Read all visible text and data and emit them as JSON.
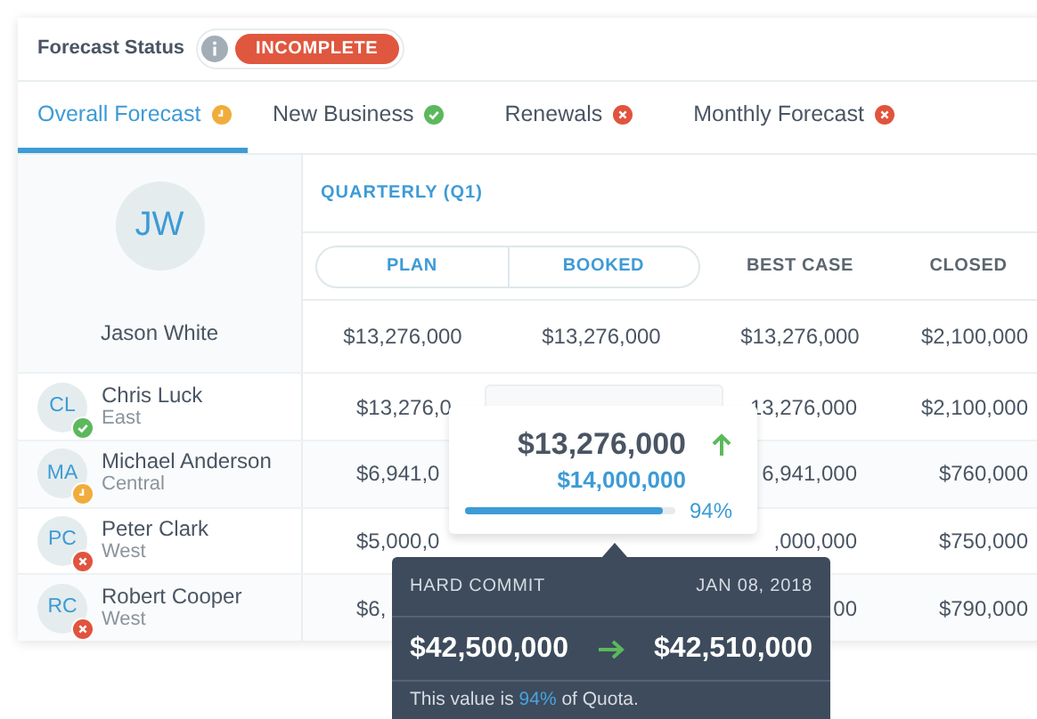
{
  "forecast_status": {
    "label": "Forecast Status",
    "badge": "INCOMPLETE"
  },
  "tabs": [
    {
      "label": "Overall Forecast",
      "selected": true,
      "kind": "pending"
    },
    {
      "label": "New Business",
      "selected": false,
      "kind": "done"
    },
    {
      "label": "Renewals",
      "selected": false,
      "kind": "error"
    },
    {
      "label": "Monthly Forecast",
      "selected": false,
      "kind": "error"
    }
  ],
  "table": {
    "period": "QUARTERLY (Q1)",
    "columns": [
      {
        "label": "PLAN",
        "kind": "segment"
      },
      {
        "label": "BOOKED",
        "kind": "segment"
      },
      {
        "label": "BEST CASE",
        "kind": "plain"
      },
      {
        "label": "CLOSED",
        "kind": "plain"
      }
    ],
    "manager": {
      "initials": "JW",
      "name": "Jason White",
      "plan": "$13,276,000",
      "booked": "$13,276,000",
      "best_case": "$13,276,000",
      "closed": "$2,100,000"
    },
    "rows": [
      {
        "initials": "CL",
        "name": "Chris Luck",
        "region": "East",
        "kind": "done",
        "plan": "$13,276,0",
        "best_case": "13,276,000",
        "closed": "$2,100,000"
      },
      {
        "initials": "MA",
        "name": "Michael Anderson",
        "region": "Central",
        "kind": "pending",
        "plan": "$6,941,0",
        "best_case": "6,941,000",
        "closed": "$760,000"
      },
      {
        "initials": "PC",
        "name": "Peter Clark",
        "region": "West",
        "kind": "error",
        "plan": "$5,000,0",
        "best_case": ",000,000",
        "closed": "$750,000"
      },
      {
        "initials": "RC",
        "name": "Robert Cooper",
        "region": "West",
        "kind": "error",
        "plan": "$6,",
        "best_case": "00",
        "closed": "$790,000"
      }
    ]
  },
  "popup": {
    "value": "$13,276,000",
    "target": "$14,000,000",
    "level": 0.94,
    "percent": "94%"
  },
  "tooltip": {
    "title": "HARD COMMIT",
    "date": "JAN 08, 2018",
    "from": "$42,500,000",
    "to": "$42,510,000",
    "note_before": "This value is",
    "note_highlight": "94%",
    "note_after": "of Quota."
  }
}
